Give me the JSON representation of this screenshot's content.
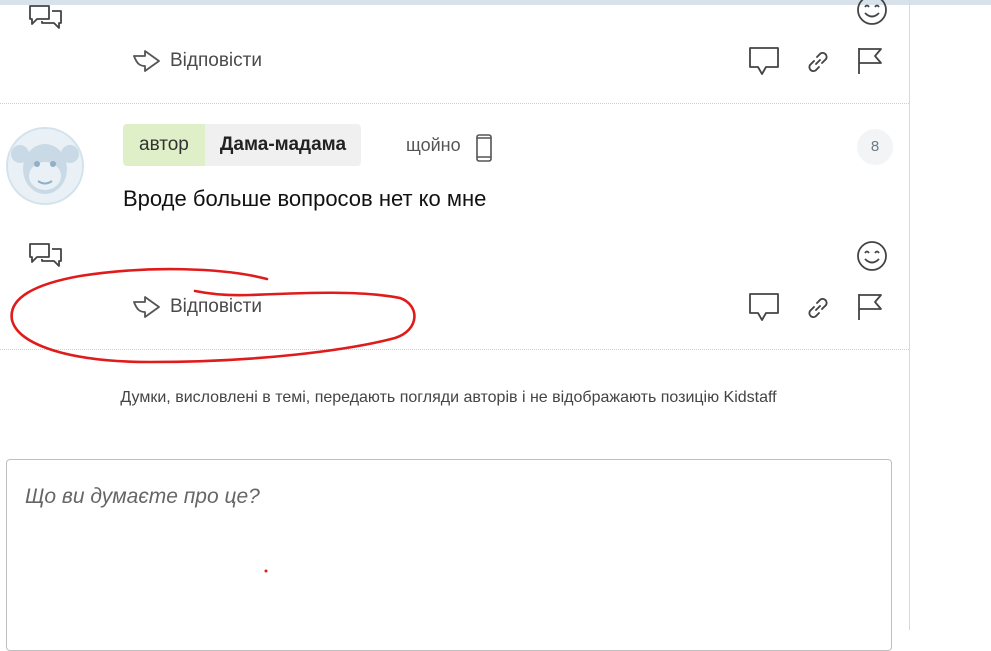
{
  "post_prev": {
    "reply_label": "Відповісти"
  },
  "post": {
    "role_badge": "автор",
    "author_name": "Дама-мадама",
    "time": "щойно",
    "number": "8",
    "body": "Вроде больше вопросов нет ко мне",
    "reply_label": "Відповісти"
  },
  "disclaimer": "Думки, висловлені в темі, передають погляди авторів і не відображають позицію Kidstaff",
  "comment": {
    "placeholder": "Що ви думаєте про це?"
  },
  "annotation": {
    "color": "#e01b1b"
  }
}
